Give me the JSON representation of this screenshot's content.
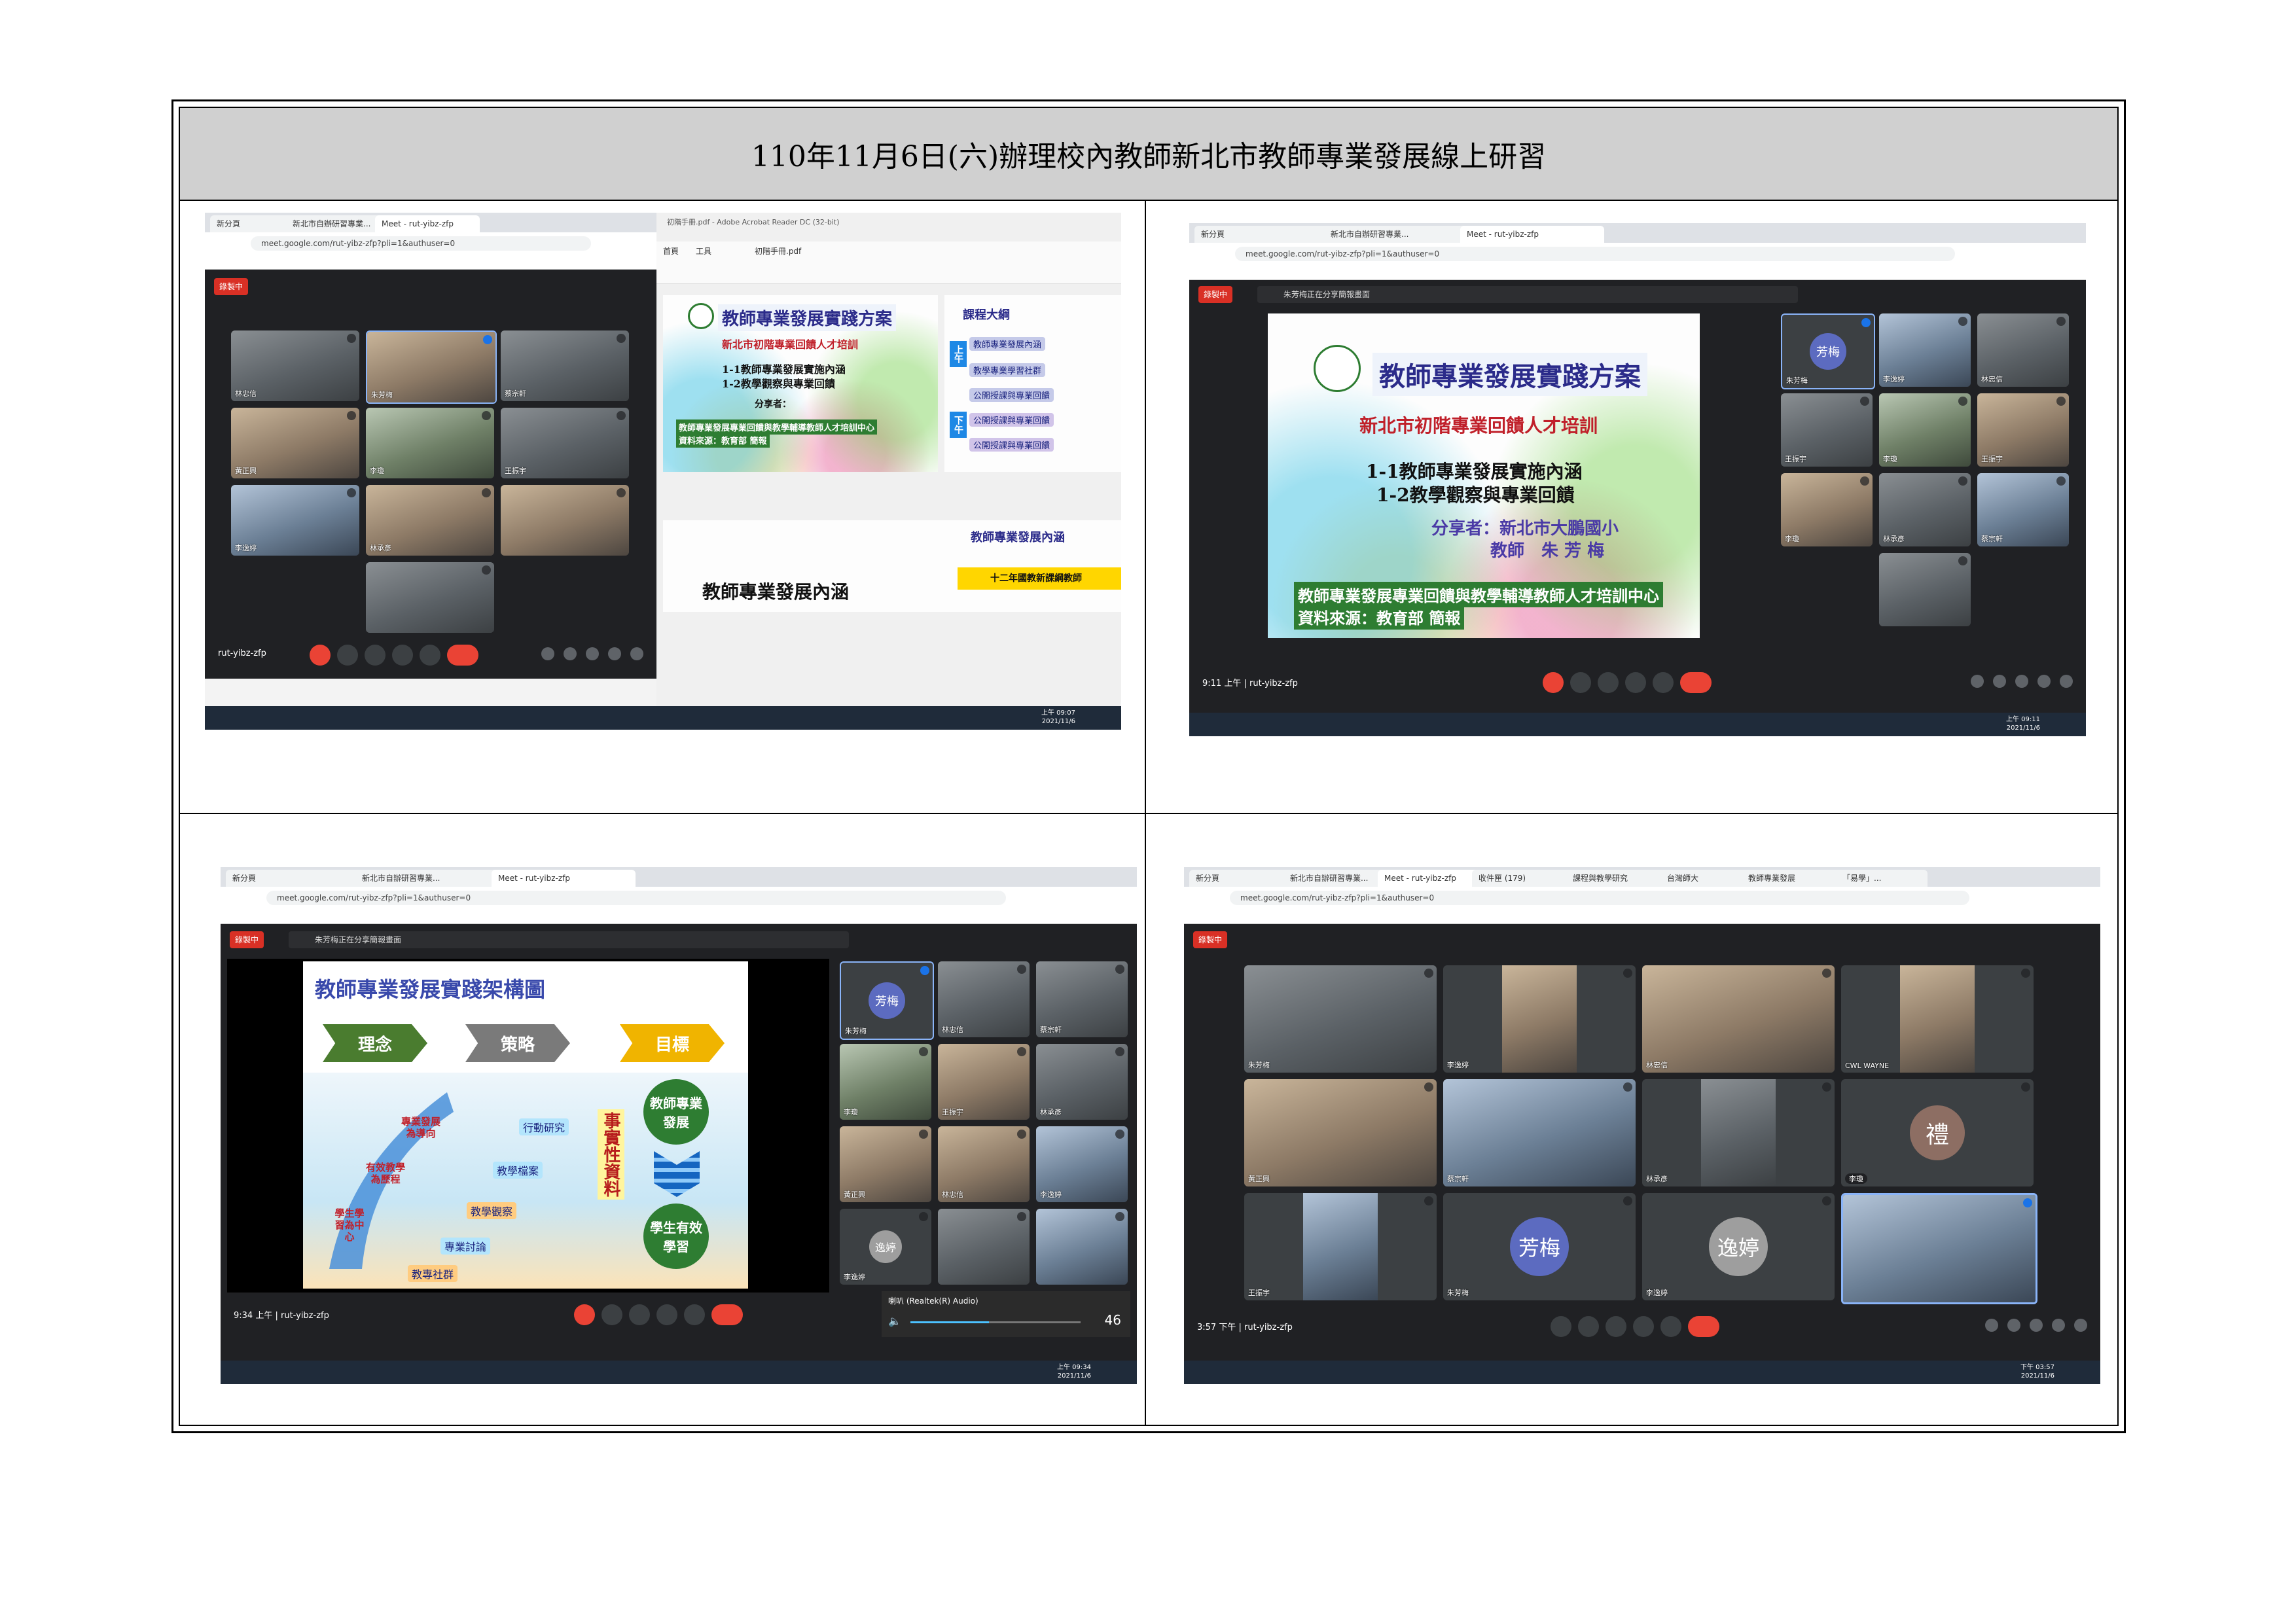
{
  "page": {
    "title": "110年11月6日(六)辦理校內教師新北市教師專業發展線上研習"
  },
  "common": {
    "meet_code": "rut-yibz-zfp",
    "recording": "錄製中",
    "url": "meet.google.com/rut-yibz-zfp?pli=1&authuser=0",
    "presenting": "朱芳梅正在分享簡報畫面",
    "date": "2021/11/6"
  },
  "shot1": {
    "tabs": [
      "新分頁",
      "新北市自辦研習專業...",
      "Meet - rut-yibz-zfp"
    ],
    "pdf_tab": "初階手冊.pdf - Adobe Acrobat Reader DC (32-bit)",
    "pdf_menu": [
      "首頁",
      "工具",
      "初階手冊.pdf"
    ],
    "tiles": [
      {
        "name": "林忠信"
      },
      {
        "name": "朱芳梅"
      },
      {
        "name": "蔡宗軒"
      },
      {
        "name": "黃正興"
      },
      {
        "name": "李瓊"
      },
      {
        "name": "王振宇"
      },
      {
        "name": "李逸婷"
      },
      {
        "name": "林承彥"
      },
      {
        "name": ""
      },
      {
        "name": ""
      }
    ],
    "slide_title": "教師專業發展實踐方案",
    "slide_sub": "新北市初階專業回饋人才培訓",
    "slide_l1": "1-1教師專業發展實施內涵",
    "slide_l2": "1-2教學觀察與專業回饋",
    "slide_share": "分享者：",
    "slide_foot1": "教師專業發展專業回饋與教學輔導教師人才培訓中心",
    "slide_foot2": "資料來源：教育部 簡報",
    "outline_title": "課程大綱",
    "outline_am": "上午",
    "outline_pm": "下午",
    "outline_items": [
      "教師專業發展內涵",
      "教學專業學習社群",
      "公開授課與專業回饋",
      "公開授課與專業回饋",
      "公開授課與專業回饋"
    ],
    "page2_title": "教師專業發展內涵",
    "page2_right": "教師專業發展內涵",
    "page2_banner": "十二年國教新課綱教師",
    "time": "上午 09:07"
  },
  "shot2": {
    "tabs": [
      "新分頁",
      "新北市自辦研習專業...",
      "Meet - rut-yibz-zfp"
    ],
    "slide_title": "教師專業發展實踐方案",
    "slide_sub": "新北市初階專業回饋人才培訓",
    "slide_l1": "1-1教師專業發展實施內涵",
    "slide_l2": "1-2教學觀察與專業回饋",
    "slide_share": "分享者：新北市大鵬國小",
    "slide_teacher": "教師　朱 芳 梅",
    "slide_foot1": "教師專業發展專業回饋與教學輔導教師人才培訓中心",
    "slide_foot2": "資料來源：教育部 簡報",
    "tiles": [
      {
        "name": "朱芳梅",
        "avatar": "芳梅"
      },
      {
        "name": "李逸婷"
      },
      {
        "name": "林忠信"
      },
      {
        "name": "王振宇"
      },
      {
        "name": "李瓊"
      },
      {
        "name": "王振宇"
      },
      {
        "name": "李瓊"
      },
      {
        "name": "林承彥"
      },
      {
        "name": "蔡宗軒"
      },
      {
        "name": ""
      }
    ],
    "meet_time": "9:11 上午",
    "time": "上午 09:11"
  },
  "shot3": {
    "tabs": [
      "新分頁",
      "新北市自辦研習專業...",
      "Meet - rut-yibz-zfp"
    ],
    "slide_title": "教師專業發展實踐架構圖",
    "chev": [
      "理念",
      "策略",
      "目標"
    ],
    "arrow_text1": "專業發展為導向",
    "arrow_text2": "有效教學為歷程",
    "arrow_text3": "學生學習為中心",
    "steps": [
      "行動研究",
      "教學檔案",
      "教學觀察",
      "專業討論",
      "教專社群"
    ],
    "evidence": "事實性資料",
    "goal1": "教師專業發展",
    "goal2": "學生有效學習",
    "tiles": [
      {
        "name": "朱芳梅",
        "avatar": "芳梅"
      },
      {
        "name": "林忠信"
      },
      {
        "name": "蔡宗軒"
      },
      {
        "name": "李瓊"
      },
      {
        "name": "王振宇"
      },
      {
        "name": "林承彥"
      },
      {
        "name": "黃正興"
      },
      {
        "name": "林忠信"
      },
      {
        "name": "李逸婷"
      },
      {
        "name": "李逸婷",
        "avatar": "逸婷"
      },
      {
        "name": ""
      },
      {
        "name": ""
      }
    ],
    "audio_label": "喇叭 (Realtek(R) Audio)",
    "volume": "46",
    "meet_time": "9:34 上午",
    "time": "上午 09:34"
  },
  "shot4": {
    "tabs": [
      "新分頁",
      "新北市自辦研習專業...",
      "Meet - rut-yibz-zfp",
      "收件匣 (179)",
      "課程與教學研究",
      "台灣師大",
      "教師專業發展",
      "「易學」..."
    ],
    "tiles": [
      {
        "name": "朱芳梅"
      },
      {
        "name": "李逸婷"
      },
      {
        "name": "林忠信"
      },
      {
        "name": "CWL WAYNE"
      },
      {
        "name": "黃正興"
      },
      {
        "name": "蔡宗軒"
      },
      {
        "name": "林承彥"
      },
      {
        "name": "李瓊",
        "avatar": "禮"
      },
      {
        "name": "王振宇"
      },
      {
        "name": "朱芳梅",
        "avatar": "芳梅"
      },
      {
        "name": "李逸婷",
        "avatar": "逸婷"
      },
      {
        "name": ""
      }
    ],
    "meet_time": "3:57 下午",
    "time": "下午 03:57"
  },
  "colors": {
    "meet_bg": "#202124",
    "tile_bg": "#3c4043",
    "record_red": "#d93025",
    "header_gray": "#d0d0d0",
    "slide_green": "#2e7d32",
    "slide_navy": "#2b2b8a"
  }
}
